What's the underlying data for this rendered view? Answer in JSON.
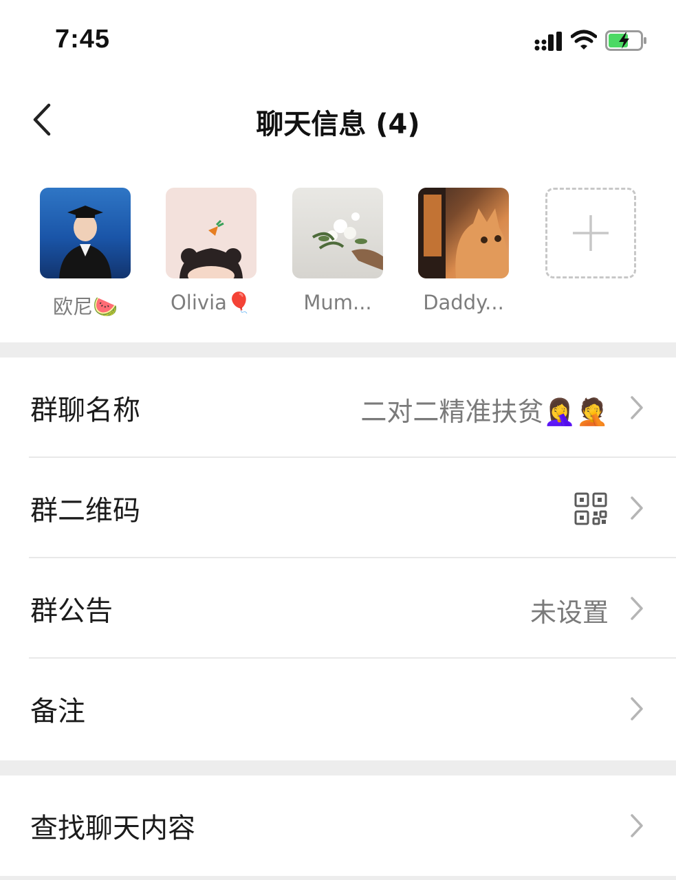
{
  "status_bar": {
    "time": "7:45",
    "icons": [
      "signal-icon",
      "wifi-icon",
      "battery-charging-icon"
    ],
    "battery_color": "#4cd964"
  },
  "nav": {
    "title": "聊天信息 (4)",
    "back_icon": "chevron-left-icon"
  },
  "members": [
    {
      "name": "欧尼🍉"
    },
    {
      "name": "Olivia🎈"
    },
    {
      "name": "Mum..."
    },
    {
      "name": "Daddy..."
    }
  ],
  "add_member_icon": "plus-icon",
  "settings": [
    {
      "label": "群聊名称",
      "value": "二对二精准扶贫🤦‍♀️🤦"
    },
    {
      "label": "群二维码",
      "value_icon": "qr-code-icon"
    },
    {
      "label": "群公告",
      "value": "未设置"
    },
    {
      "label": "备注",
      "value": ""
    },
    {
      "label": "查找聊天内容",
      "value": ""
    }
  ],
  "colors": {
    "background": "#ffffff",
    "separator": "#ededed",
    "secondary_text": "#7a7a7a"
  }
}
